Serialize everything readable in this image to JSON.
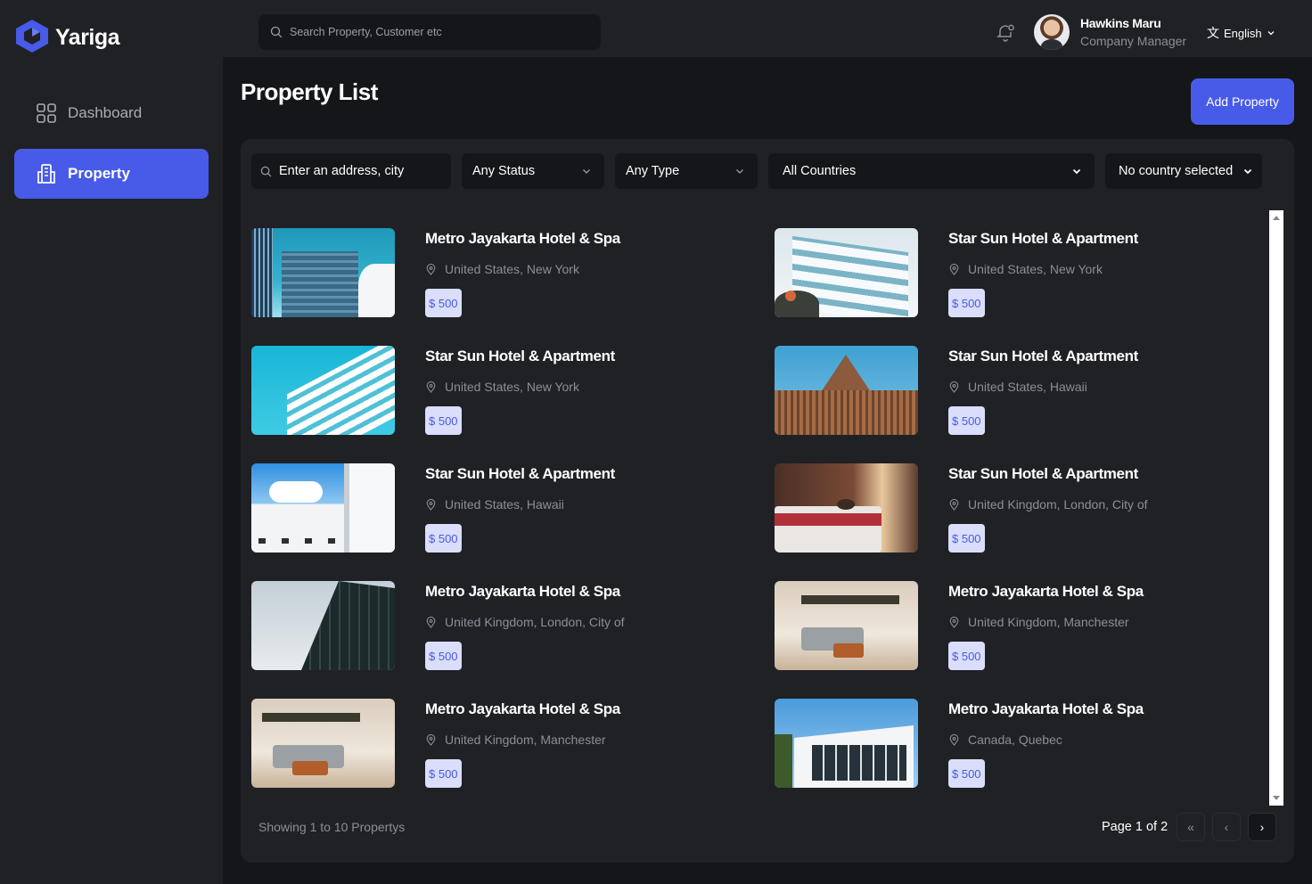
{
  "brand": {
    "name": "Yariga",
    "accent": "#475be8"
  },
  "header": {
    "search_placeholder": "Search Property, Customer etc",
    "user_name": "Hawkins Maru",
    "user_role": "Company Manager",
    "language": "English"
  },
  "sidebar": {
    "items": [
      {
        "label": "Dashboard",
        "icon": "grid-icon"
      },
      {
        "label": "Property",
        "icon": "building-icon",
        "active": true
      }
    ]
  },
  "main": {
    "title": "Property List",
    "add_button": "Add Property",
    "filters": {
      "address_placeholder": "Enter an address, city",
      "status": "Any Status",
      "type": "Any Type",
      "countries": "All Countries",
      "country_selected": "No country selected"
    },
    "properties": [
      {
        "name": "Metro Jayakarta Hotel & Spa",
        "location": "United States, New York",
        "price": "$ 500"
      },
      {
        "name": "Star Sun Hotel & Apartment",
        "location": "United States, New York",
        "price": "$ 500"
      },
      {
        "name": "Star Sun Hotel & Apartment",
        "location": "United States, New York",
        "price": "$ 500"
      },
      {
        "name": "Star Sun Hotel & Apartment",
        "location": "United States, Hawaii",
        "price": "$ 500"
      },
      {
        "name": "Star Sun Hotel & Apartment",
        "location": "United States, Hawaii",
        "price": "$ 500"
      },
      {
        "name": "Star Sun Hotel & Apartment",
        "location": "United Kingdom, London, City of",
        "price": "$ 500"
      },
      {
        "name": "Metro Jayakarta Hotel & Spa",
        "location": "United Kingdom, London, City of",
        "price": "$ 500"
      },
      {
        "name": "Metro Jayakarta Hotel & Spa",
        "location": "United Kingdom, Manchester",
        "price": "$ 500"
      },
      {
        "name": "Metro Jayakarta Hotel & Spa",
        "location": "United Kingdom, Manchester",
        "price": "$ 500"
      },
      {
        "name": "Metro Jayakarta Hotel & Spa",
        "location": "Canada, Quebec",
        "price": "$ 500"
      }
    ],
    "pagination": {
      "showing": "Showing 1 to 10 Propertys",
      "page_info": "Page 1 of 2",
      "first": "«",
      "prev": "‹",
      "next": "›"
    }
  }
}
